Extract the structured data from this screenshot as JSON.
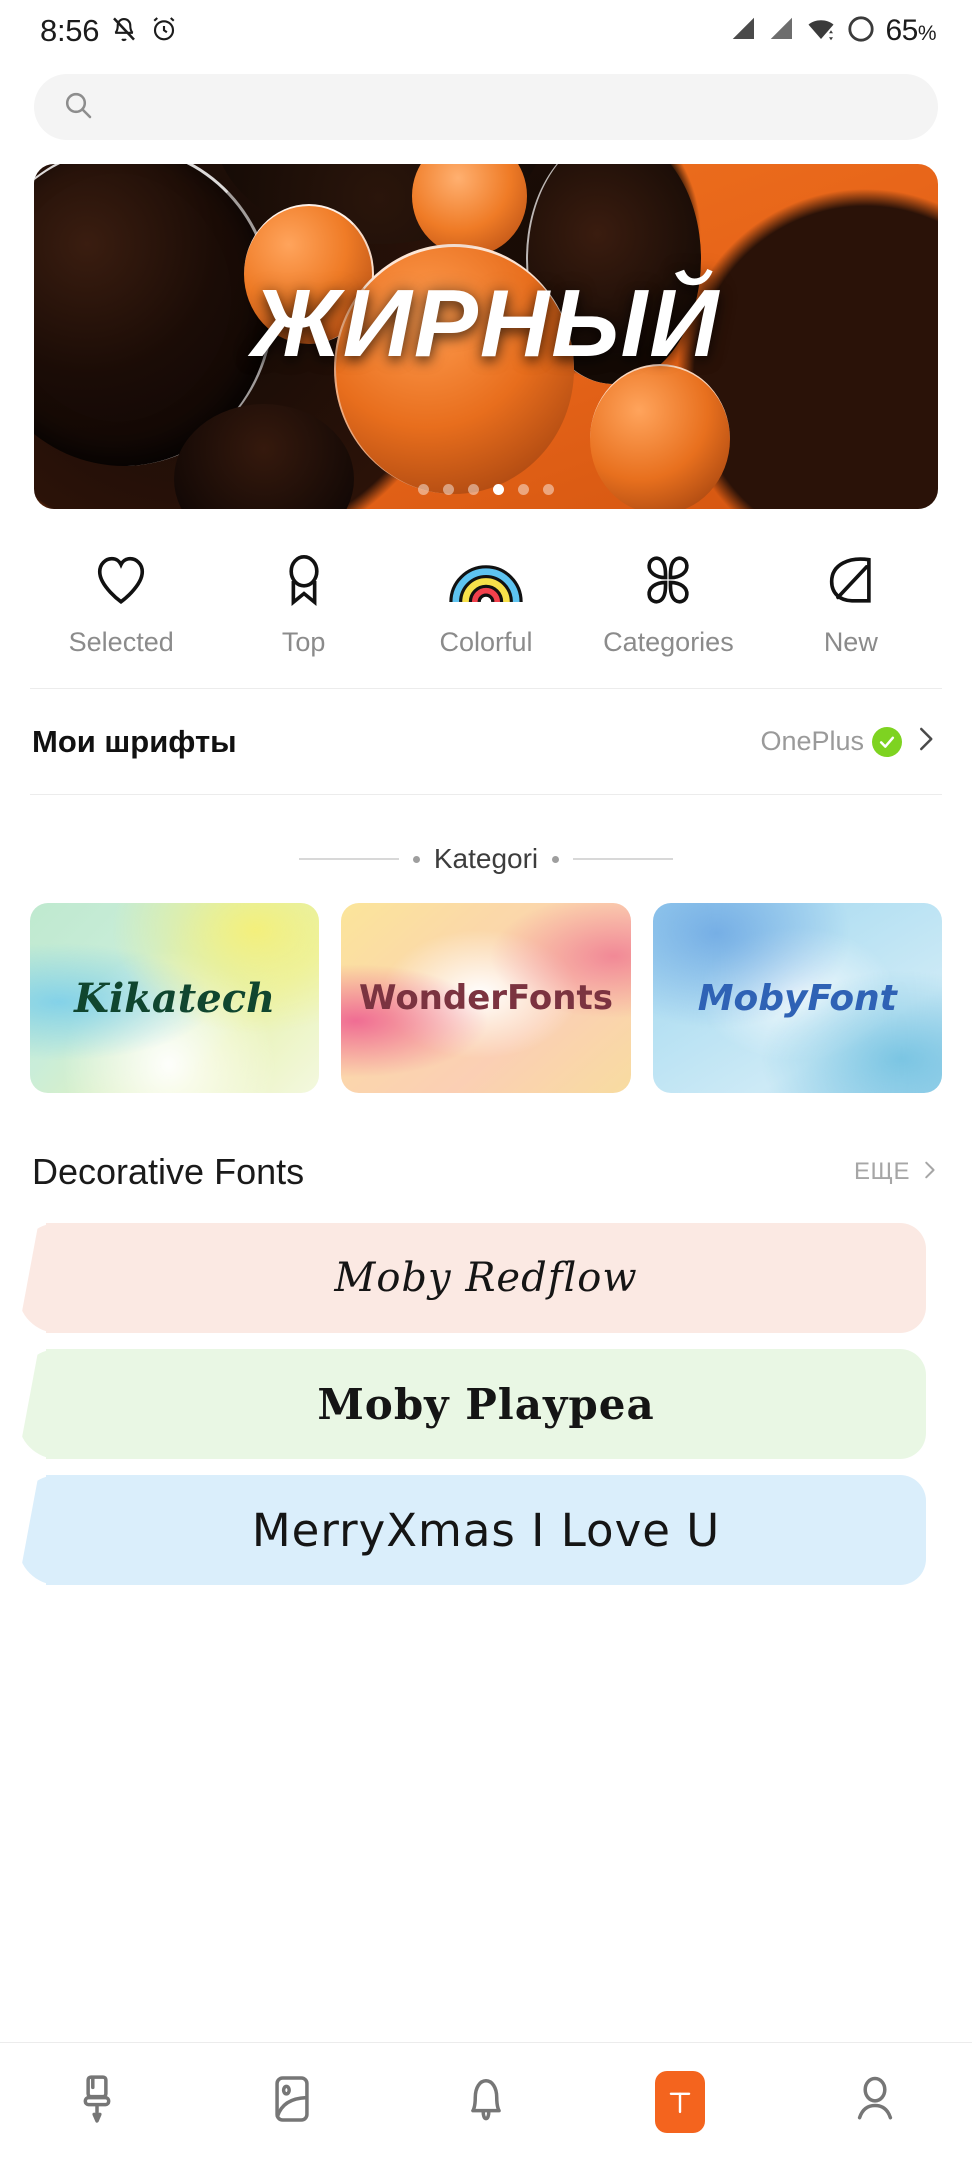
{
  "status_bar": {
    "time": "8:56",
    "icons_left": [
      "mute-bell-icon",
      "alarm-clock-icon"
    ],
    "icons_right": [
      "signal-bars-icon",
      "signal-bars-2-icon",
      "wifi-icon",
      "battery-ring-icon"
    ],
    "battery": "65",
    "battery_unit": "%"
  },
  "search": {
    "placeholder": "",
    "value": "",
    "icon": "search-icon"
  },
  "banner": {
    "title": "ЖИРНЫЙ",
    "dots_total": 6,
    "dots_active_index": 3
  },
  "quick_categories": [
    {
      "label": "Selected",
      "icon": "heart-icon"
    },
    {
      "label": "Top",
      "icon": "ribbon-badge-icon"
    },
    {
      "label": "Colorful",
      "icon": "rainbow-icon"
    },
    {
      "label": "Categories",
      "icon": "four-petal-clover-icon"
    },
    {
      "label": "New",
      "icon": "leaf-icon"
    }
  ],
  "my_fonts": {
    "title": "Мои шрифты",
    "brand": "OnePlus",
    "verified_icon": "verified-check-icon",
    "chevron_icon": "chevron-right-icon"
  },
  "kategori": {
    "label": "Kategori"
  },
  "category_cards": [
    {
      "name": "Kikatech",
      "text_color": "#10462f"
    },
    {
      "name": "WonderFonts",
      "text_color": "#7b3340"
    },
    {
      "name": "MobyFont",
      "text_color": "#2f62b5"
    }
  ],
  "decorative_section": {
    "title": "Decorative Fonts",
    "more_label": "ЕЩЕ",
    "more_icon": "chevron-right-icon"
  },
  "font_samples": [
    {
      "name": "Moby Redflow",
      "bg": "#fbe9e3"
    },
    {
      "name": "Moby Playpea",
      "bg": "#e9f7e4"
    },
    {
      "name": "MerryXmas I Love U",
      "bg": "#daeefb"
    }
  ],
  "bottom_nav": [
    {
      "icon": "paint-roller-icon",
      "active": false
    },
    {
      "icon": "wallpaper-icon",
      "active": false
    },
    {
      "icon": "bell-icon",
      "active": false
    },
    {
      "icon": "text-t-icon",
      "active": true,
      "label": "T"
    },
    {
      "icon": "profile-icon",
      "active": false
    }
  ],
  "colors": {
    "accent": "#f4641e",
    "verified_green": "#7ed321",
    "muted_text": "#8b8b8b"
  }
}
